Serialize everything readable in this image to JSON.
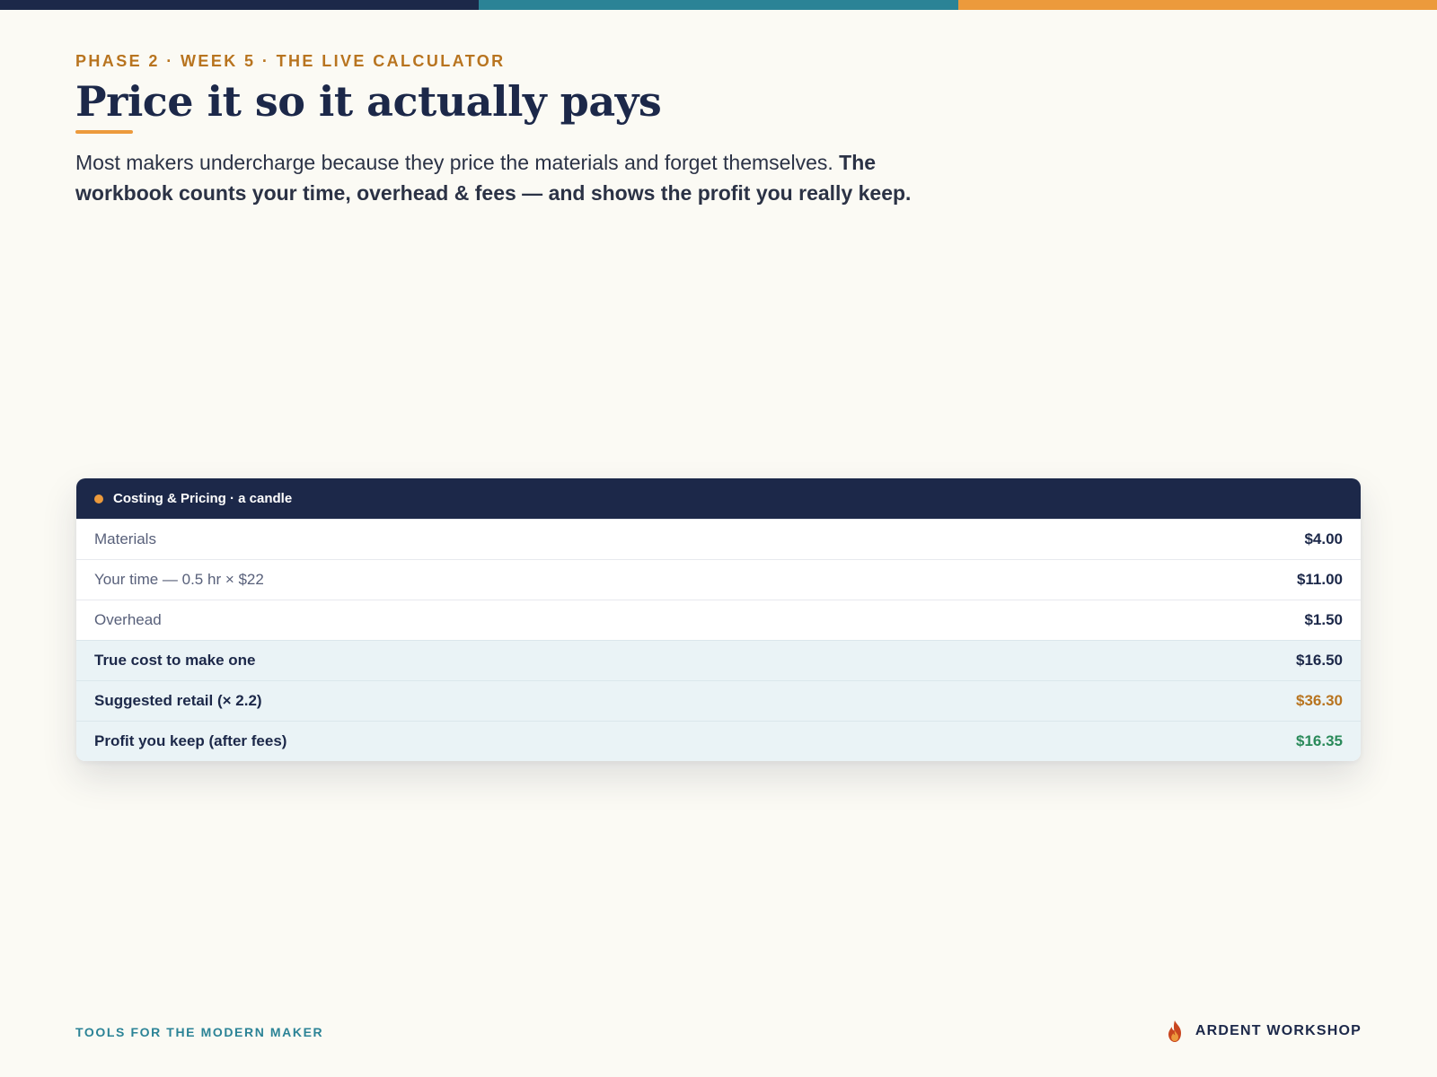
{
  "header": {
    "eyebrow": "PHASE 2 · WEEK 5 · THE LIVE CALCULATOR",
    "title": "Price it so it actually pays",
    "lead_plain": "Most makers undercharge because they price the materials and forget themselves. ",
    "lead_bold": "The workbook counts your time, overhead & fees — and shows the profit you really keep."
  },
  "calculator": {
    "title": "Costing & Pricing · a candle",
    "rows": [
      {
        "label": "Materials",
        "value": "$4.00"
      },
      {
        "label": "Your time — 0.5 hr × $22",
        "value": "$11.00"
      },
      {
        "label": "Overhead",
        "value": "$1.50"
      }
    ],
    "totals": [
      {
        "label": "True cost to make one",
        "value": "$16.50"
      },
      {
        "label": "Suggested retail (× 2.2)",
        "value": "$36.30"
      },
      {
        "label": "Profit you keep (after fees)",
        "value": "$16.35"
      }
    ]
  },
  "footer": {
    "tagline": "TOOLS FOR THE MODERN MAKER",
    "brand": "ARDENT WORKSHOP",
    "brand_icon": "flame-icon"
  },
  "colors": {
    "navy": "#1c2849",
    "teal": "#2b8396",
    "orange": "#ec9a3c",
    "gold_text": "#b8741f",
    "profit_green": "#2a8a5a",
    "background": "#fbfaf4"
  }
}
